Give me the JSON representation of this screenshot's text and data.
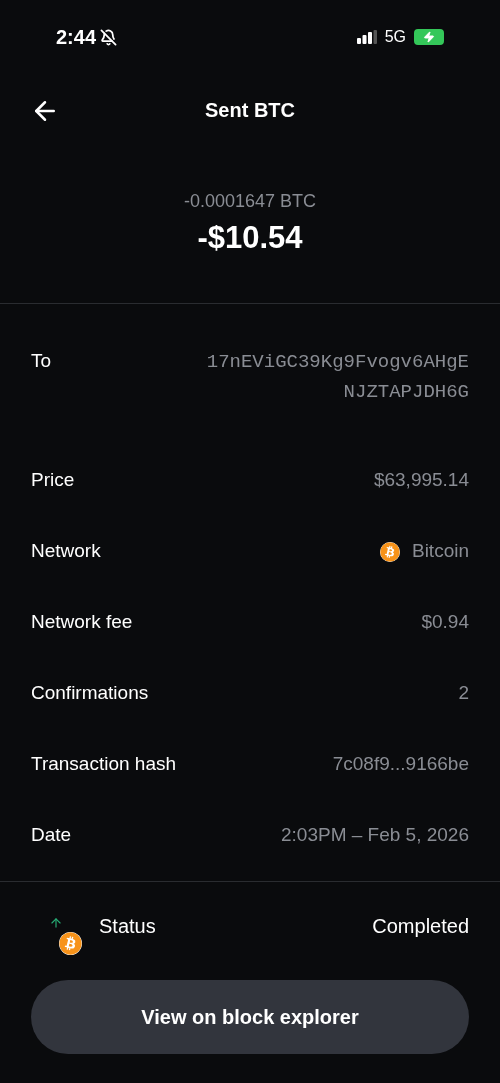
{
  "status_bar": {
    "time": "2:44",
    "network": "5G",
    "silenced": true,
    "charging": true
  },
  "header": {
    "title": "Sent BTC"
  },
  "amount": {
    "crypto": "-0.0001647 BTC",
    "fiat": "-$10.54"
  },
  "details": [
    {
      "label": "To",
      "value": "17nEViGC39Kg9Fvogv6AHgE NJZTAPJDH6G",
      "kind": "address"
    },
    {
      "label": "Price",
      "value": "$63,995.14",
      "kind": "text"
    },
    {
      "label": "Network",
      "value": "Bitcoin",
      "kind": "coin"
    },
    {
      "label": "Network fee",
      "value": "$0.94",
      "kind": "text"
    },
    {
      "label": "Confirmations",
      "value": "2",
      "kind": "text"
    },
    {
      "label": "Transaction hash",
      "value": "7c08f9...9166be",
      "kind": "text"
    },
    {
      "label": "Date",
      "value": "2:03PM – Feb 5, 2026",
      "kind": "text"
    }
  ],
  "status": {
    "label": "Status",
    "value": "Completed",
    "outgoing": true
  },
  "button": "View on block explorer"
}
